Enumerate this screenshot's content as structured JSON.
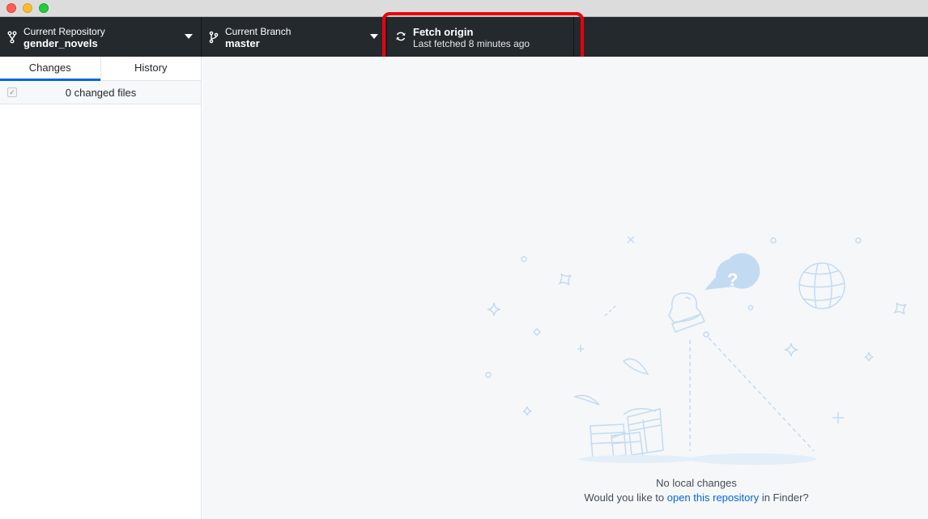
{
  "window": {
    "controls": [
      "close",
      "minimize",
      "zoom"
    ]
  },
  "toolbar": {
    "repository": {
      "label": "Current Repository",
      "value": "gender_novels",
      "icon": "repo-icon"
    },
    "branch": {
      "label": "Current Branch",
      "value": "master",
      "icon": "git-branch-icon"
    },
    "fetch": {
      "label": "Fetch origin",
      "status": "Last fetched 8 minutes ago",
      "icon": "sync-icon"
    }
  },
  "sidebar": {
    "tabs": [
      {
        "label": "Changes",
        "active": true
      },
      {
        "label": "History",
        "active": false
      }
    ],
    "changes_summary": "0 changed files",
    "select_all_mark": "✓"
  },
  "blank_slate": {
    "title": "No local changes",
    "prompt_before": "Would you like to ",
    "link_text": "open this repository",
    "prompt_after": " in Finder?"
  },
  "colors": {
    "toolbar_bg": "#24292e",
    "accent": "#0366d6",
    "highlight": "#e8000b",
    "illustration": "#c3dbf2"
  }
}
